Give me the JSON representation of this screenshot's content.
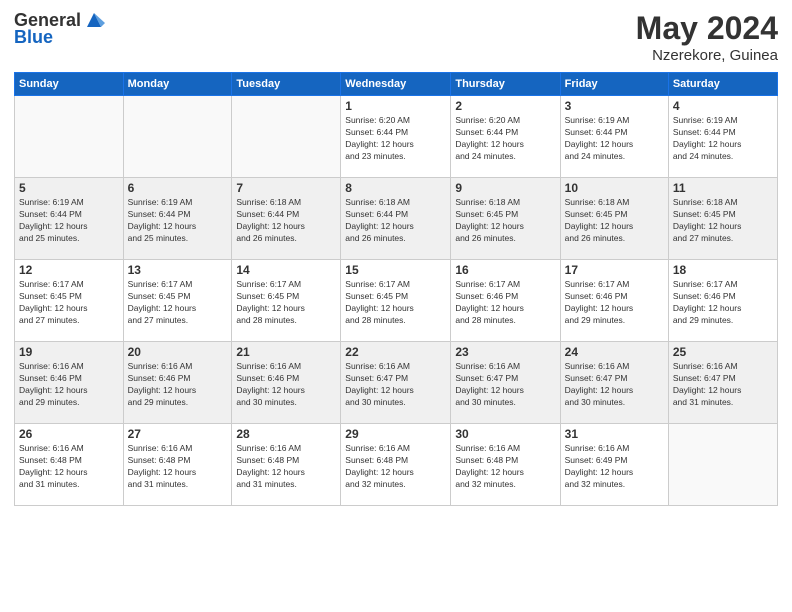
{
  "header": {
    "logo_general": "General",
    "logo_blue": "Blue",
    "month": "May 2024",
    "location": "Nzerekore, Guinea"
  },
  "weekdays": [
    "Sunday",
    "Monday",
    "Tuesday",
    "Wednesday",
    "Thursday",
    "Friday",
    "Saturday"
  ],
  "weeks": [
    [
      {
        "day": "",
        "info": ""
      },
      {
        "day": "",
        "info": ""
      },
      {
        "day": "",
        "info": ""
      },
      {
        "day": "1",
        "info": "Sunrise: 6:20 AM\nSunset: 6:44 PM\nDaylight: 12 hours\nand 23 minutes."
      },
      {
        "day": "2",
        "info": "Sunrise: 6:20 AM\nSunset: 6:44 PM\nDaylight: 12 hours\nand 24 minutes."
      },
      {
        "day": "3",
        "info": "Sunrise: 6:19 AM\nSunset: 6:44 PM\nDaylight: 12 hours\nand 24 minutes."
      },
      {
        "day": "4",
        "info": "Sunrise: 6:19 AM\nSunset: 6:44 PM\nDaylight: 12 hours\nand 24 minutes."
      }
    ],
    [
      {
        "day": "5",
        "info": "Sunrise: 6:19 AM\nSunset: 6:44 PM\nDaylight: 12 hours\nand 25 minutes."
      },
      {
        "day": "6",
        "info": "Sunrise: 6:19 AM\nSunset: 6:44 PM\nDaylight: 12 hours\nand 25 minutes."
      },
      {
        "day": "7",
        "info": "Sunrise: 6:18 AM\nSunset: 6:44 PM\nDaylight: 12 hours\nand 26 minutes."
      },
      {
        "day": "8",
        "info": "Sunrise: 6:18 AM\nSunset: 6:44 PM\nDaylight: 12 hours\nand 26 minutes."
      },
      {
        "day": "9",
        "info": "Sunrise: 6:18 AM\nSunset: 6:45 PM\nDaylight: 12 hours\nand 26 minutes."
      },
      {
        "day": "10",
        "info": "Sunrise: 6:18 AM\nSunset: 6:45 PM\nDaylight: 12 hours\nand 26 minutes."
      },
      {
        "day": "11",
        "info": "Sunrise: 6:18 AM\nSunset: 6:45 PM\nDaylight: 12 hours\nand 27 minutes."
      }
    ],
    [
      {
        "day": "12",
        "info": "Sunrise: 6:17 AM\nSunset: 6:45 PM\nDaylight: 12 hours\nand 27 minutes."
      },
      {
        "day": "13",
        "info": "Sunrise: 6:17 AM\nSunset: 6:45 PM\nDaylight: 12 hours\nand 27 minutes."
      },
      {
        "day": "14",
        "info": "Sunrise: 6:17 AM\nSunset: 6:45 PM\nDaylight: 12 hours\nand 28 minutes."
      },
      {
        "day": "15",
        "info": "Sunrise: 6:17 AM\nSunset: 6:45 PM\nDaylight: 12 hours\nand 28 minutes."
      },
      {
        "day": "16",
        "info": "Sunrise: 6:17 AM\nSunset: 6:46 PM\nDaylight: 12 hours\nand 28 minutes."
      },
      {
        "day": "17",
        "info": "Sunrise: 6:17 AM\nSunset: 6:46 PM\nDaylight: 12 hours\nand 29 minutes."
      },
      {
        "day": "18",
        "info": "Sunrise: 6:17 AM\nSunset: 6:46 PM\nDaylight: 12 hours\nand 29 minutes."
      }
    ],
    [
      {
        "day": "19",
        "info": "Sunrise: 6:16 AM\nSunset: 6:46 PM\nDaylight: 12 hours\nand 29 minutes."
      },
      {
        "day": "20",
        "info": "Sunrise: 6:16 AM\nSunset: 6:46 PM\nDaylight: 12 hours\nand 29 minutes."
      },
      {
        "day": "21",
        "info": "Sunrise: 6:16 AM\nSunset: 6:46 PM\nDaylight: 12 hours\nand 30 minutes."
      },
      {
        "day": "22",
        "info": "Sunrise: 6:16 AM\nSunset: 6:47 PM\nDaylight: 12 hours\nand 30 minutes."
      },
      {
        "day": "23",
        "info": "Sunrise: 6:16 AM\nSunset: 6:47 PM\nDaylight: 12 hours\nand 30 minutes."
      },
      {
        "day": "24",
        "info": "Sunrise: 6:16 AM\nSunset: 6:47 PM\nDaylight: 12 hours\nand 30 minutes."
      },
      {
        "day": "25",
        "info": "Sunrise: 6:16 AM\nSunset: 6:47 PM\nDaylight: 12 hours\nand 31 minutes."
      }
    ],
    [
      {
        "day": "26",
        "info": "Sunrise: 6:16 AM\nSunset: 6:48 PM\nDaylight: 12 hours\nand 31 minutes."
      },
      {
        "day": "27",
        "info": "Sunrise: 6:16 AM\nSunset: 6:48 PM\nDaylight: 12 hours\nand 31 minutes."
      },
      {
        "day": "28",
        "info": "Sunrise: 6:16 AM\nSunset: 6:48 PM\nDaylight: 12 hours\nand 31 minutes."
      },
      {
        "day": "29",
        "info": "Sunrise: 6:16 AM\nSunset: 6:48 PM\nDaylight: 12 hours\nand 32 minutes."
      },
      {
        "day": "30",
        "info": "Sunrise: 6:16 AM\nSunset: 6:48 PM\nDaylight: 12 hours\nand 32 minutes."
      },
      {
        "day": "31",
        "info": "Sunrise: 6:16 AM\nSunset: 6:49 PM\nDaylight: 12 hours\nand 32 minutes."
      },
      {
        "day": "",
        "info": ""
      }
    ]
  ]
}
